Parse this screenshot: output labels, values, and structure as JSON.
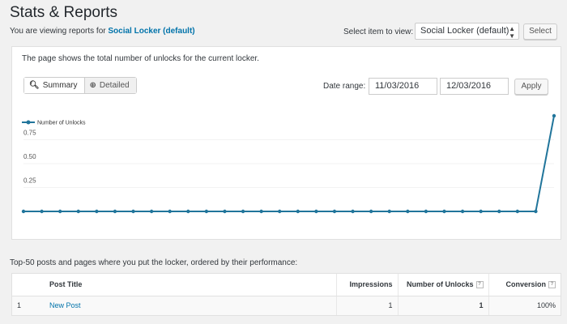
{
  "page": {
    "title": "Stats & Reports",
    "viewing_prefix": "You are viewing reports for",
    "viewing_item": "Social Locker (default)",
    "select_label": "Select item to view:",
    "select_value": "Social Locker (default)",
    "select_button": "Select"
  },
  "panel": {
    "description": "The page shows the total number of unlocks for the current locker.",
    "tabs": [
      {
        "label": "Summary",
        "icon": "search-icon",
        "active": true
      },
      {
        "label": "Detailed",
        "icon": "zoom-in-icon",
        "active": false
      }
    ],
    "date_label": "Date range:",
    "date_from": "11/03/2016",
    "date_to": "12/03/2016",
    "apply_button": "Apply"
  },
  "chart_data": {
    "type": "line",
    "series": [
      {
        "name": "Number of Unlocks",
        "values": [
          0,
          0,
          0,
          0,
          0,
          0,
          0,
          0,
          0,
          0,
          0,
          0,
          0,
          0,
          0,
          0,
          0,
          0,
          0,
          0,
          0,
          0,
          0,
          0,
          0,
          0,
          0,
          0,
          0,
          1
        ]
      }
    ],
    "y_ticks": [
      "0.25",
      "0.50",
      "0.75"
    ],
    "ylim": [
      0,
      1
    ],
    "grid": true,
    "legend": "top-left",
    "color": "#21759b"
  },
  "top_section": {
    "heading": "Top-50 posts and pages where you put the locker, ordered by their performance:",
    "columns": [
      "Post Title",
      "Impressions",
      "Number of Unlocks",
      "Conversion"
    ],
    "rows": [
      {
        "num": "1",
        "title": "New Post",
        "impressions": "1",
        "unlocks": "1",
        "conversion": "100%"
      }
    ]
  }
}
